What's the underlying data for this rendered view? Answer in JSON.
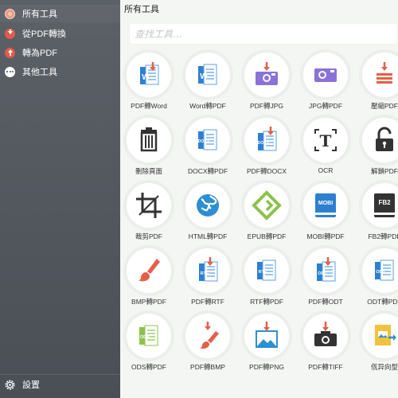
{
  "sidebar": {
    "items": [
      {
        "label": "所有工具"
      },
      {
        "label": "從PDF轉換"
      },
      {
        "label": "轉為PDF"
      },
      {
        "label": "其他工具"
      }
    ],
    "settings_label": "設置"
  },
  "main": {
    "title": "所有工具",
    "search_placeholder": "查找工具..."
  },
  "tools": [
    {
      "label": "PDF轉Word",
      "icon": "pdf-to-word-icon"
    },
    {
      "label": "Word轉PDF",
      "icon": "word-to-pdf-icon"
    },
    {
      "label": "PDF轉JPG",
      "icon": "pdf-to-jpg-icon"
    },
    {
      "label": "JPG轉PDF",
      "icon": "jpg-to-pdf-icon"
    },
    {
      "label": "壓縮PDF",
      "icon": "compress-pdf-icon"
    },
    {
      "label": "刪除頁面",
      "icon": "trash-icon"
    },
    {
      "label": "DOCX轉PDF",
      "icon": "docx-to-pdf-icon"
    },
    {
      "label": "PDF轉DOCX",
      "icon": "pdf-to-docx-icon"
    },
    {
      "label": "OCR",
      "icon": "ocr-icon"
    },
    {
      "label": "解鎖PDF",
      "icon": "unlock-icon"
    },
    {
      "label": "裁剪PDF",
      "icon": "crop-icon"
    },
    {
      "label": "HTML轉PDF",
      "icon": "globe-icon"
    },
    {
      "label": "EPUB轉PDF",
      "icon": "epub-icon"
    },
    {
      "label": "MOBI轉PDF",
      "icon": "mobi-icon"
    },
    {
      "label": "FB2轉PDF",
      "icon": "fb2-icon"
    },
    {
      "label": "BMP轉PDF",
      "icon": "paintbrush-icon"
    },
    {
      "label": "PDF轉RTF",
      "icon": "pdf-to-rtf-icon"
    },
    {
      "label": "RTF轉PDF",
      "icon": "rtf-to-pdf-icon"
    },
    {
      "label": "PDF轉ODT",
      "icon": "pdf-to-odt-icon"
    },
    {
      "label": "ODT轉PDF",
      "icon": "odt-to-pdf-icon"
    },
    {
      "label": "ODS轉PDF",
      "icon": "ods-to-pdf-icon"
    },
    {
      "label": "PDF轉BMP",
      "icon": "pdf-to-bmp-icon"
    },
    {
      "label": "PDF轉PNG",
      "icon": "pdf-to-png-icon"
    },
    {
      "label": "PDF轉TIFF",
      "icon": "pdf-to-tiff-icon"
    },
    {
      "label": "佤异向型",
      "icon": "image-convert-icon"
    }
  ],
  "colors": {
    "sidebar": "#4f545b",
    "accent_red": "#e45f48",
    "word_blue": "#2d7fd2",
    "purple": "#8a72d8",
    "green": "#8bc34a",
    "orange": "#f2a73b"
  }
}
